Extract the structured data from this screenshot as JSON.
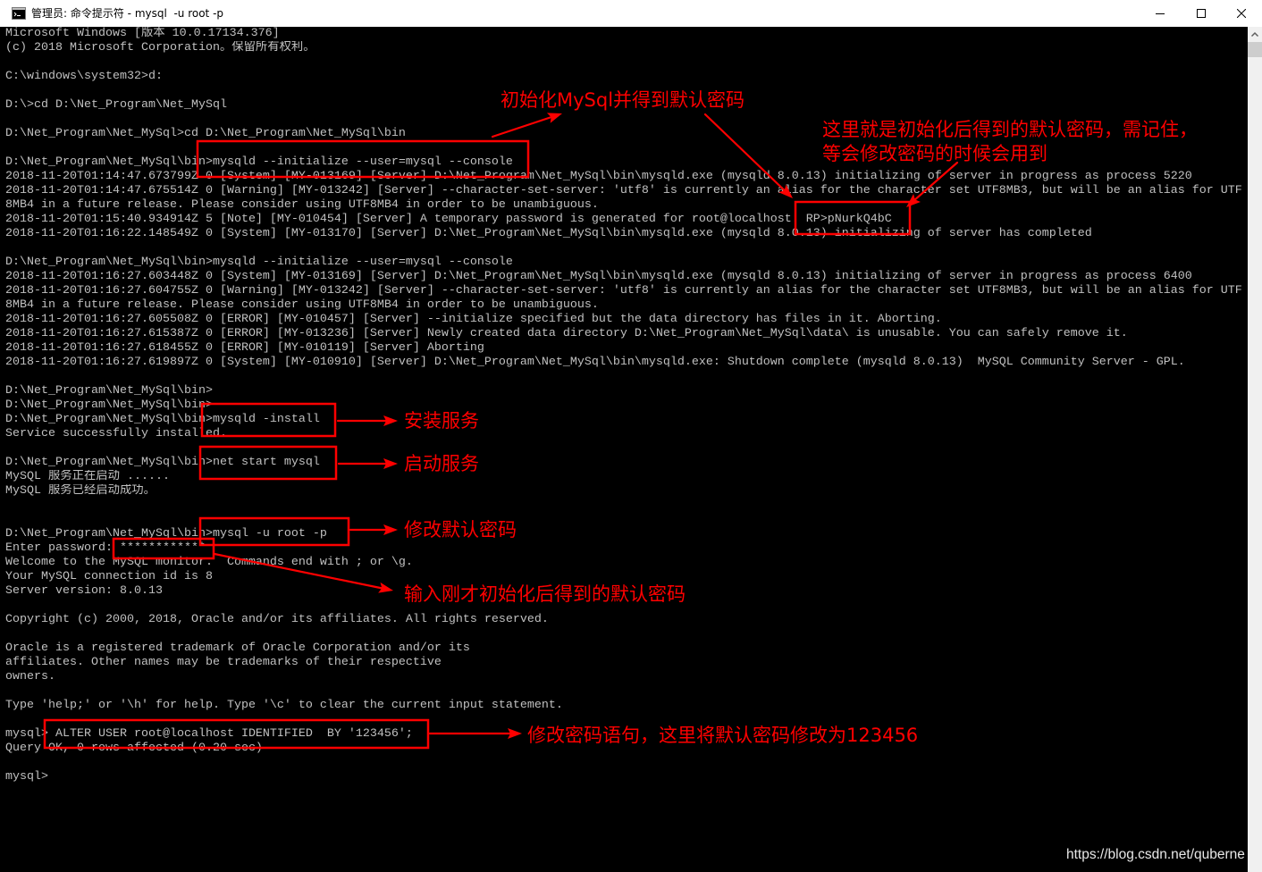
{
  "window": {
    "title": "管理员: 命令提示符 - mysql  -u root -p",
    "icon": "cmd-app-icon",
    "controls": {
      "minimize": "minimize-icon",
      "maximize": "maximize-icon",
      "close": "close-icon"
    }
  },
  "scrollbar": {
    "up_icon": "chevron-up-icon"
  },
  "console": {
    "lines": [
      "Microsoft Windows [版本 10.0.17134.376]",
      "(c) 2018 Microsoft Corporation。保留所有权利。",
      "",
      "C:\\windows\\system32>d:",
      "",
      "D:\\>cd D:\\Net_Program\\Net_MySql",
      "",
      "D:\\Net_Program\\Net_MySql>cd D:\\Net_Program\\Net_MySql\\bin",
      "",
      "D:\\Net_Program\\Net_MySql\\bin>mysqld --initialize --user=mysql --console",
      "2018-11-20T01:14:47.673799Z 0 [System] [MY-013169] [Server] D:\\Net_Program\\Net_MySql\\bin\\mysqld.exe (mysqld 8.0.13) initializing of server in progress as process 5220",
      "2018-11-20T01:14:47.675514Z 0 [Warning] [MY-013242] [Server] --character-set-server: 'utf8' is currently an alias for the character set UTF8MB3, but will be an alias for UTF",
      "8MB4 in a future release. Please consider using UTF8MB4 in order to be unambiguous.",
      "2018-11-20T01:15:40.934914Z 5 [Note] [MY-010454] [Server] A temporary password is generated for root@localhost: RP>pNurkQ4bC",
      "2018-11-20T01:16:22.148549Z 0 [System] [MY-013170] [Server] D:\\Net_Program\\Net_MySql\\bin\\mysqld.exe (mysqld 8.0.13) initializing of server has completed",
      "",
      "D:\\Net_Program\\Net_MySql\\bin>mysqld --initialize --user=mysql --console",
      "2018-11-20T01:16:27.603448Z 0 [System] [MY-013169] [Server] D:\\Net_Program\\Net_MySql\\bin\\mysqld.exe (mysqld 8.0.13) initializing of server in progress as process 6400",
      "2018-11-20T01:16:27.604755Z 0 [Warning] [MY-013242] [Server] --character-set-server: 'utf8' is currently an alias for the character set UTF8MB3, but will be an alias for UTF",
      "8MB4 in a future release. Please consider using UTF8MB4 in order to be unambiguous.",
      "2018-11-20T01:16:27.605508Z 0 [ERROR] [MY-010457] [Server] --initialize specified but the data directory has files in it. Aborting.",
      "2018-11-20T01:16:27.615387Z 0 [ERROR] [MY-013236] [Server] Newly created data directory D:\\Net_Program\\Net_MySql\\data\\ is unusable. You can safely remove it.",
      "2018-11-20T01:16:27.618455Z 0 [ERROR] [MY-010119] [Server] Aborting",
      "2018-11-20T01:16:27.619897Z 0 [System] [MY-010910] [Server] D:\\Net_Program\\Net_MySql\\bin\\mysqld.exe: Shutdown complete (mysqld 8.0.13)  MySQL Community Server - GPL.",
      "",
      "D:\\Net_Program\\Net_MySql\\bin>",
      "D:\\Net_Program\\Net_MySql\\bin>",
      "D:\\Net_Program\\Net_MySql\\bin>mysqld -install",
      "Service successfully installed.",
      "",
      "D:\\Net_Program\\Net_MySql\\bin>net start mysql",
      "MySQL 服务正在启动 ......",
      "MySQL 服务已经启动成功。",
      "",
      "",
      "D:\\Net_Program\\Net_MySql\\bin>mysql -u root -p",
      "Enter password: ************",
      "Welcome to the MySQL monitor.  Commands end with ; or \\g.",
      "Your MySQL connection id is 8",
      "Server version: 8.0.13",
      "",
      "Copyright (c) 2000, 2018, Oracle and/or its affiliates. All rights reserved.",
      "",
      "Oracle is a registered trademark of Oracle Corporation and/or its",
      "affiliates. Other names may be trademarks of their respective",
      "owners.",
      "",
      "Type 'help;' or '\\h' for help. Type '\\c' to clear the current input statement.",
      "",
      "mysql> ALTER USER root@localhost IDENTIFIED  BY '123456';",
      "Query OK, 0 rows affected (0.20 sec)",
      "",
      "mysql>"
    ]
  },
  "annotations": {
    "init_label": "初始化MySql并得到默认密码",
    "password_note": [
      "这里就是初始化后得到的默认密码，需记住，",
      "等会修改密码的时候会用到"
    ],
    "install_label": "安装服务",
    "start_label": "启动服务",
    "login_label": "修改默认密码",
    "enter_password_label": "输入刚才初始化后得到的默认密码",
    "alter_label": "修改密码语句，这里将默认密码修改为123456"
  },
  "watermark": "https://blog.csdn.net/quberne",
  "colors": {
    "console_background": "#000000",
    "console_text": "#c0c0c0",
    "annotation": "#ff0000",
    "title_bar": "#ffffff",
    "title_text": "#000000",
    "scrollbar_track": "#f0f0f0",
    "scrollbar_thumb": "#cdcdcd",
    "watermark": "#e8e8e8"
  }
}
